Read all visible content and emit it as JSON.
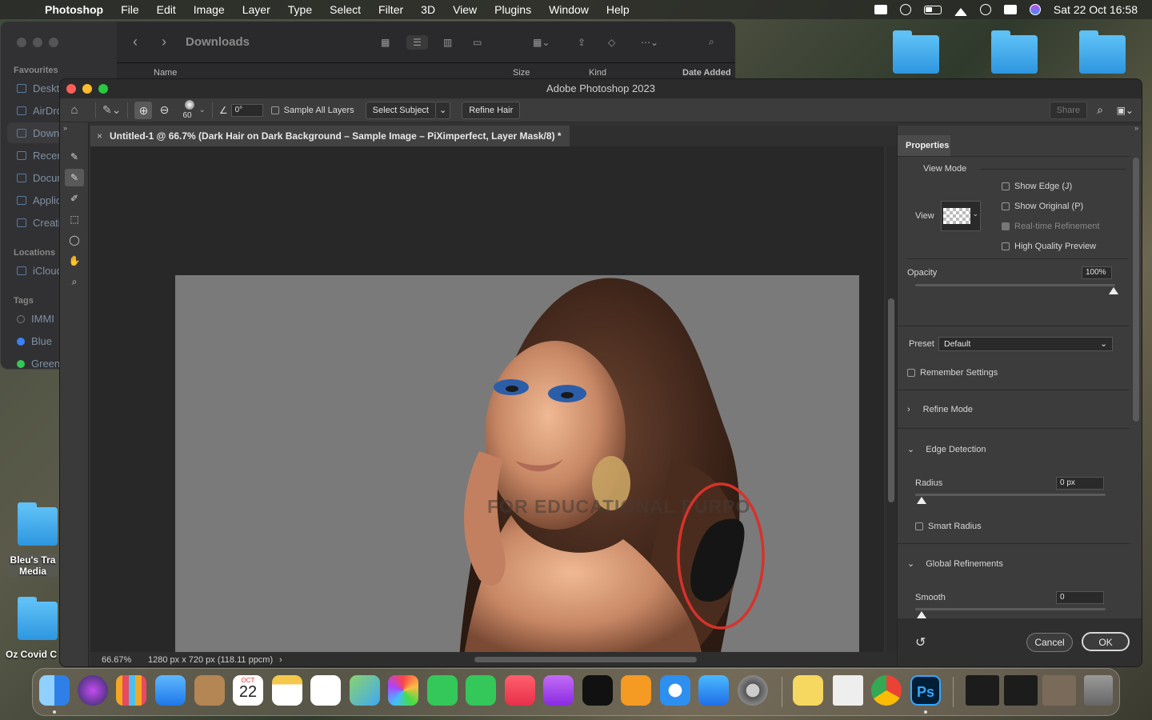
{
  "menubar": {
    "app": "Photoshop",
    "items": [
      "File",
      "Edit",
      "Image",
      "Layer",
      "Type",
      "Select",
      "Filter",
      "3D",
      "View",
      "Plugins",
      "Window",
      "Help"
    ],
    "datetime": "Sat 22 Oct  16:58"
  },
  "finder": {
    "title": "Downloads",
    "favourites_label": "Favourites",
    "locations_label": "Locations",
    "tags_label": "Tags",
    "fav_items": [
      "Desktop",
      "AirDrop",
      "Downloads",
      "Recents",
      "Documents",
      "Applications",
      "Creative Cloud"
    ],
    "location_items": [
      "iCloud"
    ],
    "tag_items": [
      "IMMI",
      "Blue",
      "Green"
    ],
    "columns": {
      "name": "Name",
      "size": "Size",
      "kind": "Kind",
      "date": "Date Added"
    }
  },
  "desktop": {
    "folder1": "Bleu's Tra\nMedia",
    "folder2": "Oz Covid C"
  },
  "ps": {
    "title": "Adobe Photoshop 2023",
    "options": {
      "brush_size": "60",
      "angle": "0°",
      "sample_all": "Sample All Layers",
      "select_subject": "Select Subject",
      "refine_hair": "Refine Hair",
      "share": "Share"
    },
    "doc_tab": "Untitled-1 @ 66.7% (Dark Hair on Dark Background –  Sample Image – PiXimperfect, Layer Mask/8) *",
    "status": {
      "zoom": "66.67%",
      "dims": "1280 px x 720 px (118.11 ppcm)"
    },
    "watermark": "FOR EDUCATIONAL PURPO"
  },
  "props": {
    "tab": "Properties",
    "view_mode": "View Mode",
    "view": "View",
    "show_edge": "Show Edge (J)",
    "show_original": "Show Original (P)",
    "realtime": "Real-time Refinement",
    "hq_preview": "High Quality Preview",
    "opacity": "Opacity",
    "opacity_val": "100%",
    "preset": "Preset",
    "preset_val": "Default",
    "remember": "Remember Settings",
    "refine_mode": "Refine Mode",
    "edge_detection": "Edge Detection",
    "radius": "Radius",
    "radius_val": "0 px",
    "smart_radius": "Smart Radius",
    "global_ref": "Global Refinements",
    "smooth": "Smooth",
    "smooth_val": "0",
    "cancel": "Cancel",
    "ok": "OK"
  },
  "dock": {
    "calendar_month": "OCT",
    "calendar_day": "22"
  },
  "colors": {
    "accent_red": "#d7322b",
    "ps_blue": "#31a8ff"
  }
}
